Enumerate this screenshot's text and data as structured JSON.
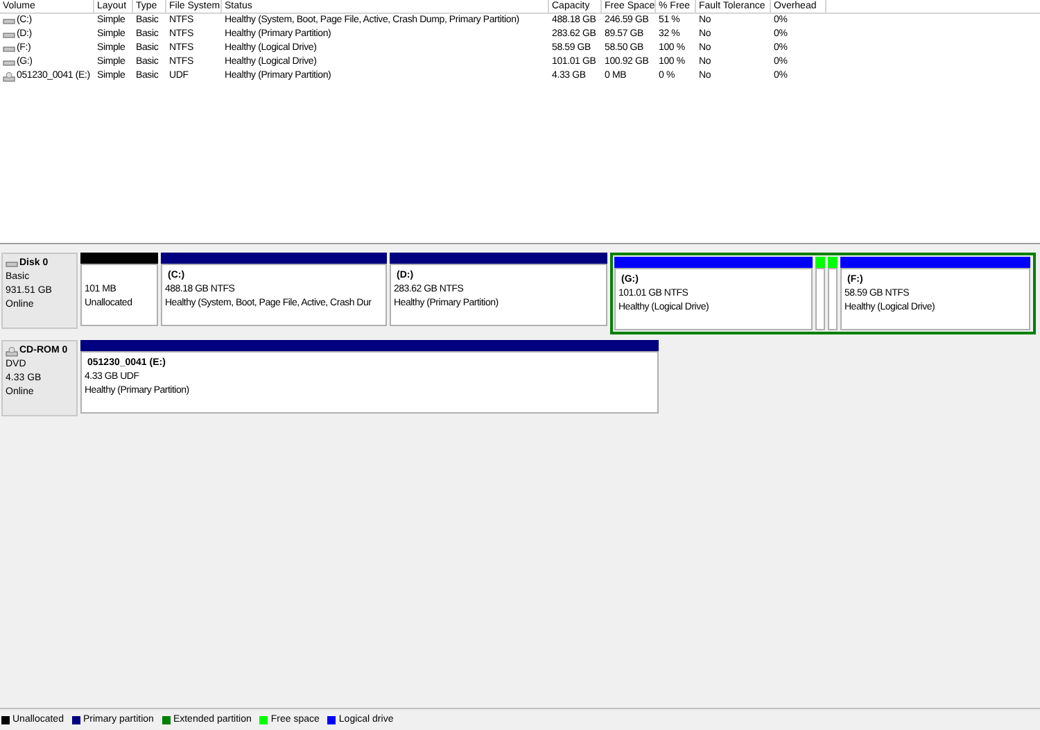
{
  "volume_table": {
    "columns": [
      "Volume",
      "Layout",
      "Type",
      "File System",
      "Status",
      "Capacity",
      "Free Space",
      "% Free",
      "Fault Tolerance",
      "Overhead"
    ],
    "rows": [
      {
        "kind": "hdd",
        "cells": [
          "(C:)",
          "Simple",
          "Basic",
          "NTFS",
          "Healthy (System, Boot, Page File, Active, Crash Dump, Primary Partition)",
          "488.18 GB",
          "246.59 GB",
          "51 %",
          "No",
          "0%"
        ]
      },
      {
        "kind": "hdd",
        "cells": [
          "(D:)",
          "Simple",
          "Basic",
          "NTFS",
          "Healthy (Primary Partition)",
          "283.62 GB",
          "89.57 GB",
          "32 %",
          "No",
          "0%"
        ]
      },
      {
        "kind": "hdd",
        "cells": [
          "(F:)",
          "Simple",
          "Basic",
          "NTFS",
          "Healthy (Logical Drive)",
          "58.59 GB",
          "58.50 GB",
          "100 %",
          "No",
          "0%"
        ]
      },
      {
        "kind": "hdd",
        "cells": [
          "(G:)",
          "Simple",
          "Basic",
          "NTFS",
          "Healthy (Logical Drive)",
          "101.01 GB",
          "100.92 GB",
          "100 %",
          "No",
          "0%"
        ]
      },
      {
        "kind": "cdrom",
        "cells": [
          "051230_0041 (E:)",
          "Simple",
          "Basic",
          "UDF",
          "Healthy (Primary Partition)",
          "4.33 GB",
          "0 MB",
          "0 %",
          "No",
          "0%"
        ]
      }
    ]
  },
  "disks": [
    {
      "kind": "hdd",
      "name": "Disk 0",
      "lines": [
        "Basic",
        "931.51 GB",
        "Online"
      ],
      "partitions": [
        {
          "kind": "unallocated",
          "lines": [
            "101 MB",
            "Unallocated"
          ]
        },
        {
          "kind": "primary",
          "title": "(C:)",
          "lines": [
            "488.18 GB NTFS",
            "Healthy (System, Boot, Page File, Active, Crash Dur"
          ]
        },
        {
          "kind": "primary",
          "title": "(D:)",
          "lines": [
            "283.62 GB NTFS",
            "Healthy (Primary Partition)"
          ]
        },
        {
          "kind": "extended",
          "children": [
            {
              "kind": "logical",
              "title": "(G:)",
              "lines": [
                "101.01 GB NTFS",
                "Healthy (Logical Drive)"
              ]
            },
            {
              "kind": "free"
            },
            {
              "kind": "free"
            },
            {
              "kind": "logical",
              "title": "(F:)",
              "lines": [
                "58.59 GB NTFS",
                "Healthy (Logical Drive)"
              ]
            }
          ]
        }
      ]
    },
    {
      "kind": "cdrom",
      "name": "CD-ROM 0",
      "lines": [
        "DVD",
        "4.33 GB",
        "Online"
      ],
      "partitions": [
        {
          "kind": "primary",
          "title": "051230_0041  (E:)",
          "lines": [
            "4.33 GB UDF",
            "Healthy (Primary Partition)"
          ]
        }
      ]
    }
  ],
  "legend": [
    {
      "label": "Unallocated",
      "color": "#000000"
    },
    {
      "label": "Primary partition",
      "color": "#000080"
    },
    {
      "label": "Extended partition",
      "color": "#008000"
    },
    {
      "label": "Free space",
      "color": "#00ff00"
    },
    {
      "label": "Logical drive",
      "color": "#0000ff"
    }
  ]
}
